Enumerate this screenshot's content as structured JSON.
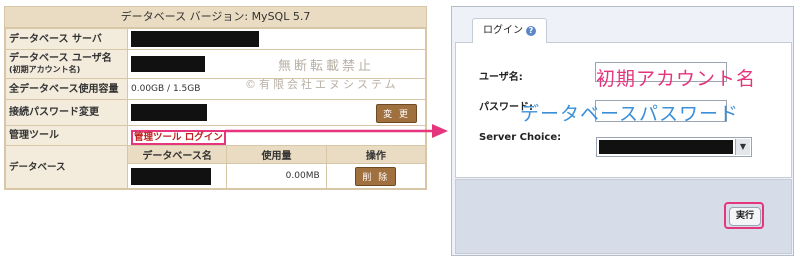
{
  "server_info": {
    "title": "データベース バージョン: MySQL 5.7",
    "rows": {
      "db_server": "データベース サーバ",
      "db_user_line1": "データベース ユーザ名",
      "db_user_line2": "(初期アカウント名)",
      "total_usage_label": "全データベース使用容量",
      "total_usage_value": "0.00GB / 1.5GB",
      "password_change_label": "接続パスワード変更",
      "password_change_button": "変 更",
      "admin_tool_label": "管理ツール",
      "admin_tool_link": "管理ツール ログイン",
      "database_label": "データベース"
    },
    "db_table": {
      "headers": [
        "データベース名",
        "使用量",
        "操作"
      ],
      "usage": "0.00MB",
      "delete_button": "削 除"
    }
  },
  "watermark": {
    "line1": "無断転載禁止",
    "line2": "©有限会社エヌシステム"
  },
  "login": {
    "tab_label": "ログイン",
    "username_label": "ユーザ名:",
    "password_label": "パスワード:",
    "server_choice_label": "Server Choice:",
    "submit_label": "実行"
  },
  "annotations": {
    "username_note": "初期アカウント名",
    "password_note": "データベースパスワード"
  },
  "colors": {
    "highlight": "#e4357d",
    "password_note": "#3b8fd9",
    "panel_header": "#e9dcc3"
  }
}
